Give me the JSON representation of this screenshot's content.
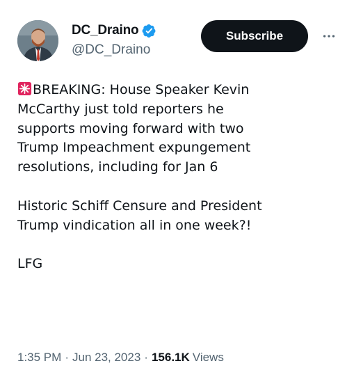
{
  "author": {
    "display_name": "DC_Draino",
    "handle": "@DC_Draino",
    "verified": true,
    "verified_color": "#1d9bf0"
  },
  "actions": {
    "subscribe_label": "Subscribe",
    "more_icon": "more-dots-icon"
  },
  "post": {
    "emoji": "siren-icon",
    "lines": [
      "BREAKING: House Speaker Kevin",
      "McCarthy just told reporters he",
      "supports moving forward with two",
      "Trump Impeachment expungement",
      "resolutions, including for Jan 6"
    ],
    "paragraph2_lines": [
      "Historic Schiff Censure and President",
      "Trump vindication all in one week?!"
    ],
    "paragraph3": "LFG"
  },
  "meta": {
    "time": "1:35 PM",
    "separator": "·",
    "date": "Jun 23, 2023",
    "views_count": "156.1K",
    "views_label": "Views"
  },
  "colors": {
    "text": "#0f1419",
    "secondary": "#536471",
    "button_bg": "#0f1419",
    "button_text": "#ffffff"
  }
}
